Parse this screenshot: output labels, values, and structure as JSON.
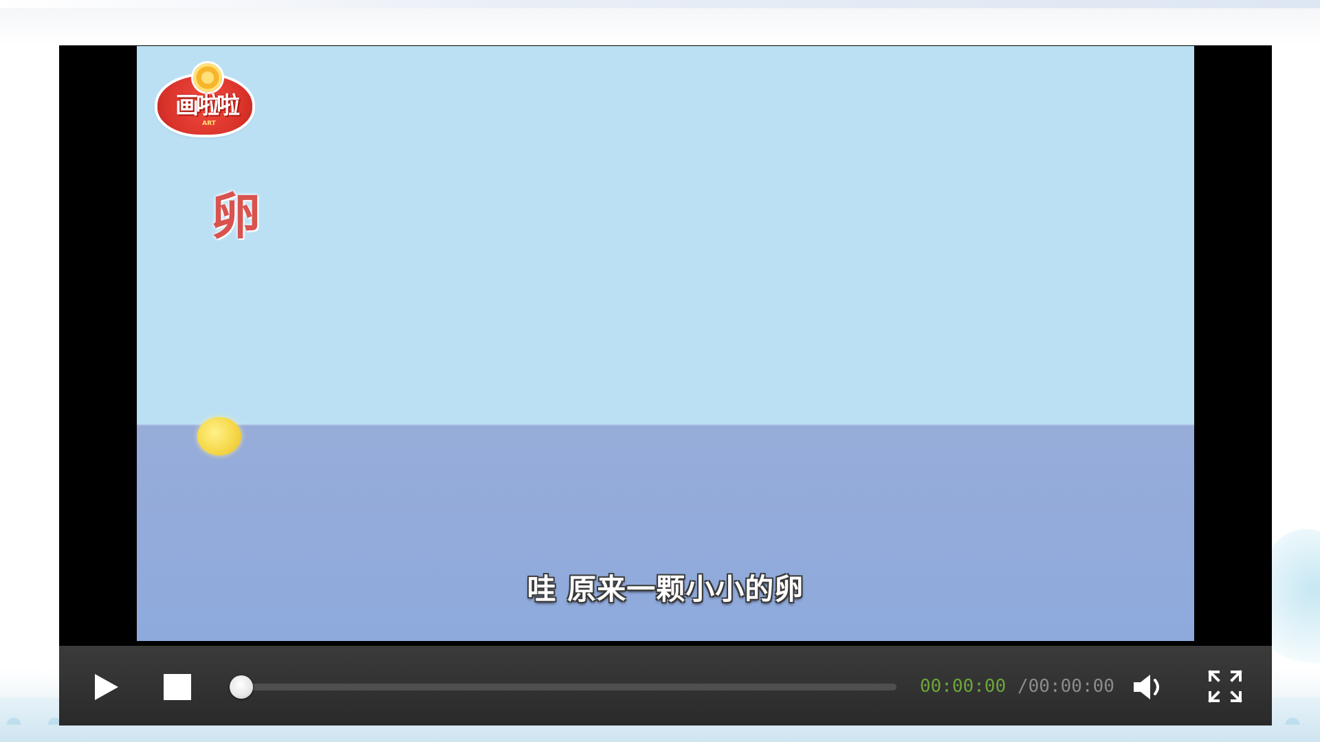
{
  "video": {
    "logo_text": "画啦啦",
    "logo_subtext": "ART",
    "title_character": "卵",
    "subtitle": "哇 原来一颗小小的卵"
  },
  "controls": {
    "current_time": "00:00:00",
    "total_time": "/00:00:00",
    "progress_fraction": 0,
    "icons": {
      "play": "play-icon",
      "stop": "stop-icon",
      "volume": "volume-icon",
      "fullscreen": "fullscreen-icon"
    },
    "colors": {
      "current_time": "#6da63a",
      "total_time": "#8c8c8c"
    }
  }
}
